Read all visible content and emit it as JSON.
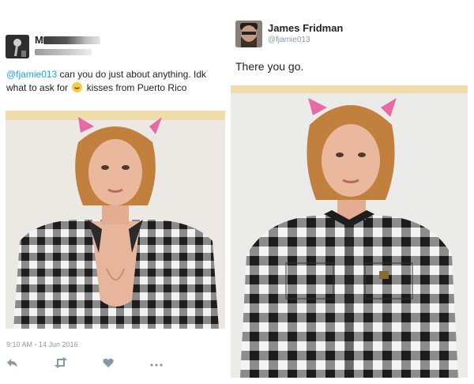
{
  "left_tweet": {
    "author_name_visible": "M",
    "author_handle_obscured": true,
    "text_mention": "@fjamie013",
    "text_line1_rest": " can you do just about anything. Idk",
    "text_line2_start": "what to ask for",
    "text_line2_end": "kisses from Puerto Rico",
    "timestamp": "9:10 AM - 14 Jun 2016",
    "actions": [
      "reply-icon",
      "retweet-icon",
      "like-icon",
      "more-icon"
    ]
  },
  "right_tweet": {
    "author_name": "James Fridman",
    "author_handle": "@fjamie013",
    "text": "There you go."
  },
  "colors": {
    "mention": "#1da1f2",
    "meta": "#8899a6",
    "band": "#efdcaa",
    "plaid_dark": "#1e1e1e",
    "hair": "#c2803e"
  }
}
